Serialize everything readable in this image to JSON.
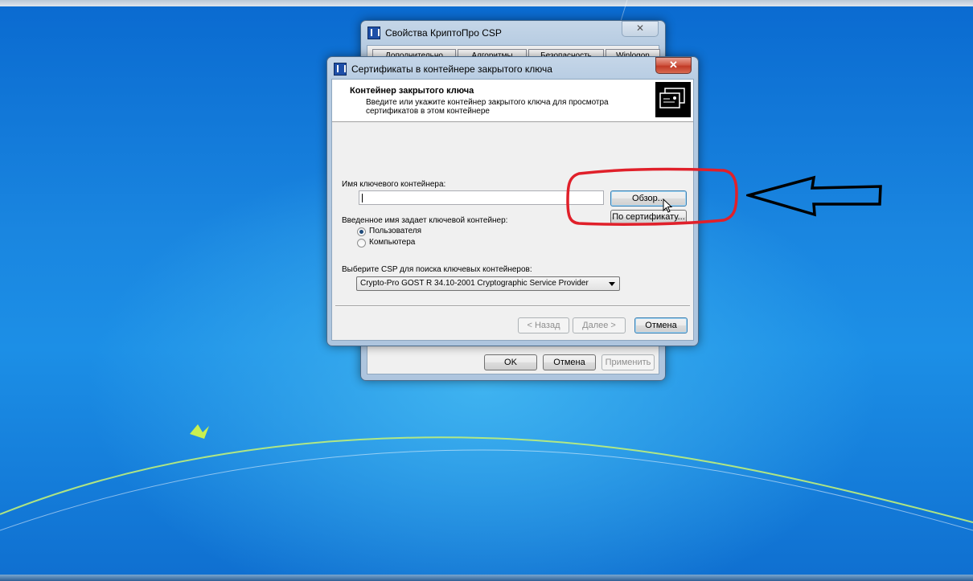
{
  "back_window": {
    "title": "Свойства КриптоПро CSP",
    "tabs": [
      "Дополнительно",
      "Алгоритмы",
      "Безопасность",
      "Winlogon"
    ],
    "buttons": {
      "ok": "OK",
      "cancel": "Отмена",
      "apply": "Применить"
    }
  },
  "dialog": {
    "title": "Сертификаты в контейнере закрытого ключа",
    "header_title": "Контейнер закрытого ключа",
    "header_desc_line1": "Введите или укажите контейнер закрытого ключа для просмотра",
    "header_desc_line2": "сертификатов в этом контейнере",
    "container_label": "Имя ключевого контейнера:",
    "container_value": "",
    "browse_button": "Обзор...",
    "by_cert_button": "По сертификату...",
    "entered_name_label": "Введенное имя задает ключевой контейнер:",
    "radio_user": "Пользователя",
    "radio_computer": "Компьютера",
    "radio_selected": "user",
    "csp_label": "Выберите CSP для поиска ключевых контейнеров:",
    "csp_selected": "Crypto-Pro GOST R 34.10-2001 Cryptographic Service Provider",
    "back_button": "< Назад",
    "next_button": "Далее >",
    "cancel_button": "Отмена"
  },
  "colors": {
    "highlight": "#e0202a",
    "arrow": "#000000",
    "close": "#c9473a"
  }
}
